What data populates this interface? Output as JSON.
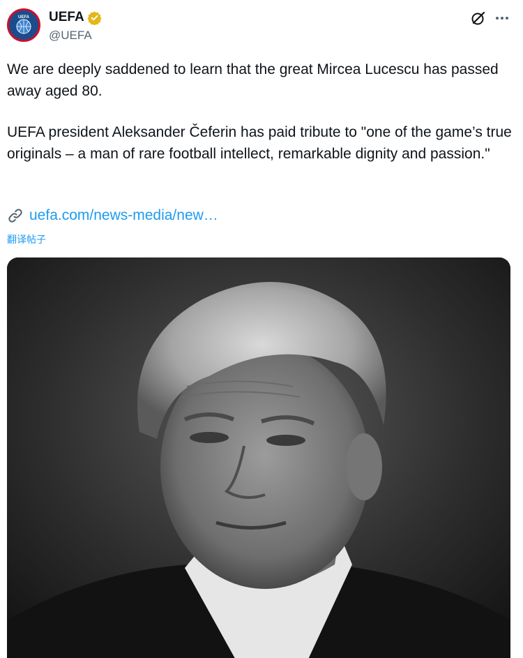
{
  "account": {
    "display_name": "UEFA",
    "handle": "@UEFA",
    "verified_badge_color": "#e2b719"
  },
  "tweet": {
    "paragraph_1": "We are deeply saddened to learn that the great Mircea Lucescu has passed away aged 80.",
    "paragraph_2": "UEFA president Aleksander Čeferin has paid tribute to \"one of the game’s true originals – a man of rare football intellect, remarkable dignity and passion.\"",
    "link_text": "uefa.com/news-media/new…",
    "translate_label": "翻译帖子"
  },
  "icons": {
    "avatar": "uefa-logo",
    "verified": "verified-badge-icon",
    "grok": "grok-icon",
    "more": "more-icon",
    "link": "link-icon"
  },
  "colors": {
    "link": "#1d9bf0",
    "secondary_text": "#536471",
    "primary_text": "#0f1419"
  }
}
